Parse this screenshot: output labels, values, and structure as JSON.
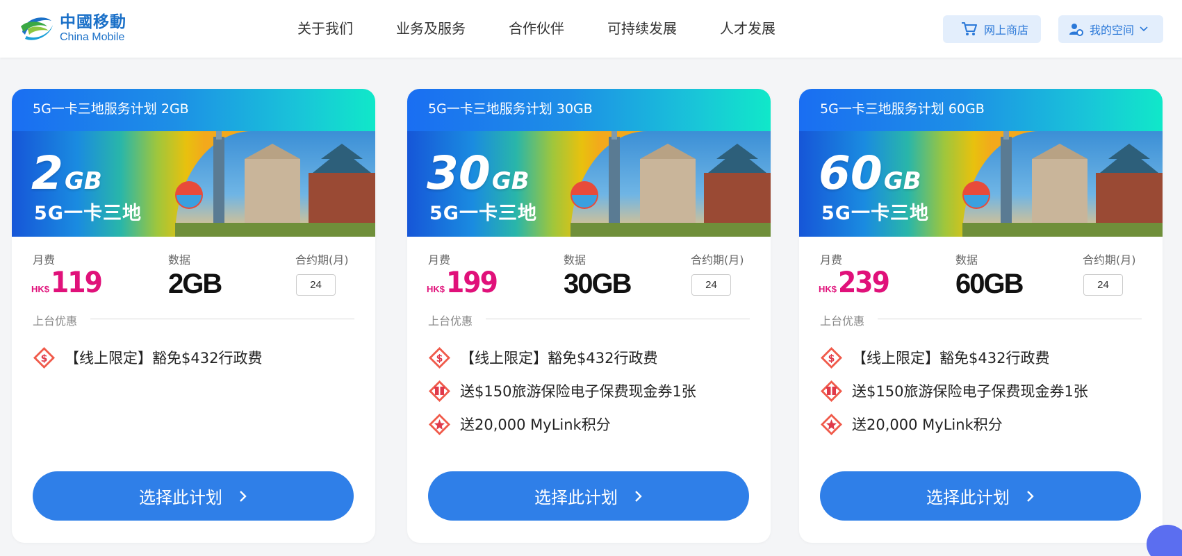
{
  "header": {
    "logo_cn": "中國移動",
    "logo_en": "China Mobile",
    "nav": [
      "关于我们",
      "业务及服务",
      "合作伙伴",
      "可持续发展",
      "人才发展"
    ],
    "shop_label": "网上商店",
    "space_label": "我的空间"
  },
  "labels": {
    "monthly_fee": "月费",
    "data": "数据",
    "contract": "合约期(月)",
    "promo_title": "上台优惠",
    "currency": "HK$",
    "select_button": "选择此计划",
    "banner_sub": "5G一卡三地"
  },
  "plans": [
    {
      "title": "5G一卡三地服务计划 2GB",
      "banner_gb": "2",
      "banner_unit": "GB",
      "price": "119",
      "data": "2GB",
      "term": "24",
      "promos": [
        "【线上限定】豁免$432行政费"
      ]
    },
    {
      "title": "5G一卡三地服务计划 30GB",
      "banner_gb": "30",
      "banner_unit": "GB",
      "price": "199",
      "data": "30GB",
      "term": "24",
      "promos": [
        "【线上限定】豁免$432行政费",
        "送$150旅游保险电子保费现金券1张",
        "送20,000 MyLink积分"
      ]
    },
    {
      "title": "5G一卡三地服务计划 60GB",
      "banner_gb": "60",
      "banner_unit": "GB",
      "price": "239",
      "data": "60GB",
      "term": "24",
      "promos": [
        "【线上限定】豁免$432行政费",
        "送$150旅游保险电子保费现金券1张",
        "送20,000 MyLink积分"
      ]
    }
  ],
  "colors": {
    "brand": "#1a70c8",
    "price": "#e0117a",
    "button": "#2f7fe8"
  }
}
